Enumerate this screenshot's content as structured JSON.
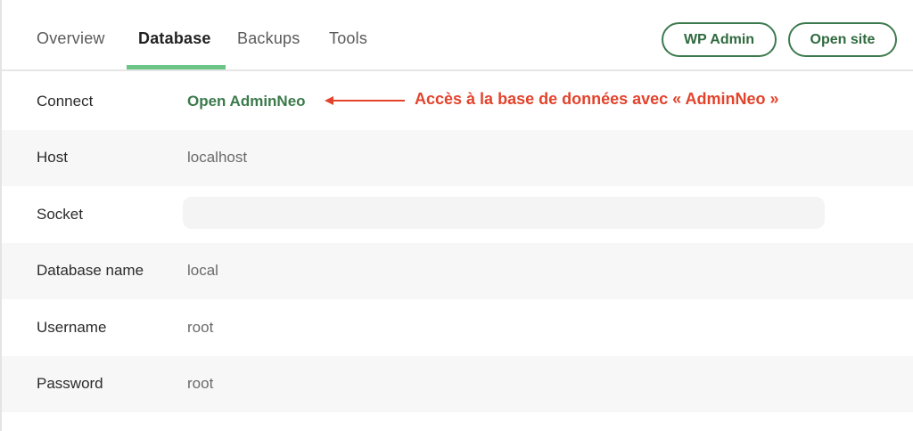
{
  "tabs": {
    "overview": "Overview",
    "database": "Database",
    "backups": "Backups",
    "tools": "Tools",
    "active": "Database"
  },
  "buttons": {
    "wp_admin": "WP Admin",
    "open_site": "Open site"
  },
  "rows": {
    "connect": {
      "label": "Connect",
      "value": "Open AdminNeo"
    },
    "host": {
      "label": "Host",
      "value": "localhost"
    },
    "socket": {
      "label": "Socket",
      "value": ""
    },
    "database_name": {
      "label": "Database name",
      "value": "local"
    },
    "username": {
      "label": "Username",
      "value": "root"
    },
    "password": {
      "label": "Password",
      "value": "root"
    }
  },
  "annotation": {
    "text": "Accès à la base de données avec « AdminNeo »",
    "color": "#e3432b"
  },
  "colors": {
    "accent_green": "#3c7a4d",
    "tab_underline": "#6cc487",
    "row_shade": "#f7f7f7"
  },
  "icons": {
    "annotation_arrow": "arrow-left-icon"
  }
}
